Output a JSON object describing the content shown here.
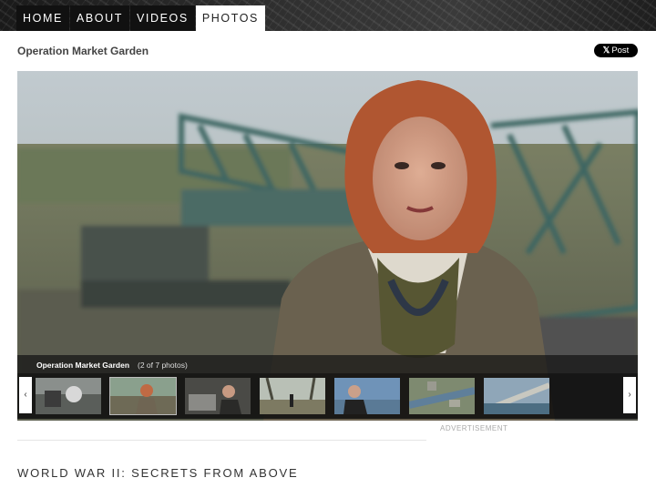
{
  "nav": {
    "items": [
      {
        "label": "HOME",
        "active": false
      },
      {
        "label": "ABOUT",
        "active": false
      },
      {
        "label": "VIDEOS",
        "active": false
      },
      {
        "label": "PHOTOS",
        "active": true
      }
    ]
  },
  "header": {
    "title": "Operation Market Garden",
    "post_button": {
      "icon": "x-logo-icon",
      "label": "Post"
    }
  },
  "gallery": {
    "caption_title": "Operation Market Garden",
    "caption_count": "(2 of 7 photos)",
    "prev_icon": "chevron-left-icon",
    "next_icon": "chevron-right-icon",
    "thumbnails": [
      {
        "name": "thumb-1",
        "active": false
      },
      {
        "name": "thumb-2",
        "active": true
      },
      {
        "name": "thumb-3",
        "active": false
      },
      {
        "name": "thumb-4",
        "active": false
      },
      {
        "name": "thumb-5",
        "active": false
      },
      {
        "name": "thumb-6",
        "active": false
      },
      {
        "name": "thumb-7",
        "active": false
      }
    ]
  },
  "ad_label": "ADVERTISEMENT",
  "section_title": "WORLD WAR II: SECRETS FROM ABOVE",
  "colors": {
    "nav_bg": "#111111",
    "nav_active_bg": "#ffffff",
    "caption_bar": "#141414"
  }
}
